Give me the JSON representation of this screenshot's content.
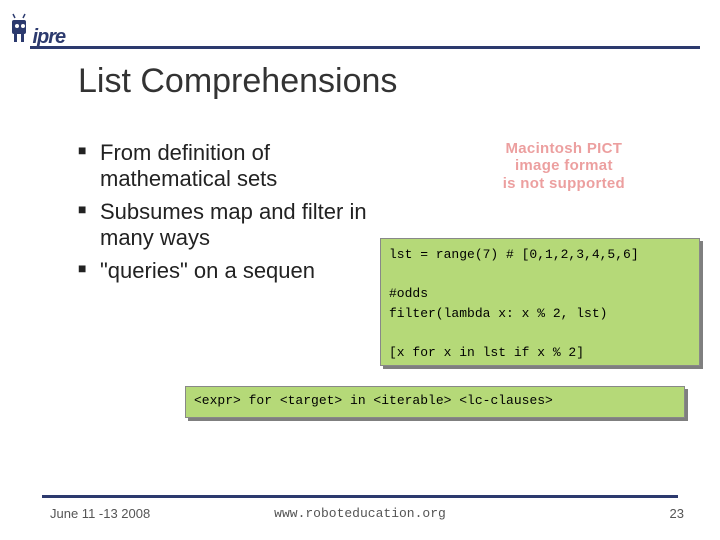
{
  "logo": {
    "text": "ipre"
  },
  "title": "List Comprehensions",
  "bullets": [
    "From definition of mathematical sets",
    "Subsumes map and filter in many ways",
    "\"queries\" on a sequen"
  ],
  "placeholder": {
    "line1": "Macintosh PICT",
    "line2": "image format",
    "line3": "is not supported"
  },
  "code_main": "lst = range(7) # [0,1,2,3,4,5,6]\n\n#odds\nfilter(lambda x: x % 2, lst)\n\n[x for x in lst if x % 2]",
  "code_syntax": "<expr> for <target> in <iterable> <lc-clauses>",
  "footer": {
    "date": "June 11 -13 2008",
    "url": "www.roboteducation.org",
    "page": "23"
  }
}
